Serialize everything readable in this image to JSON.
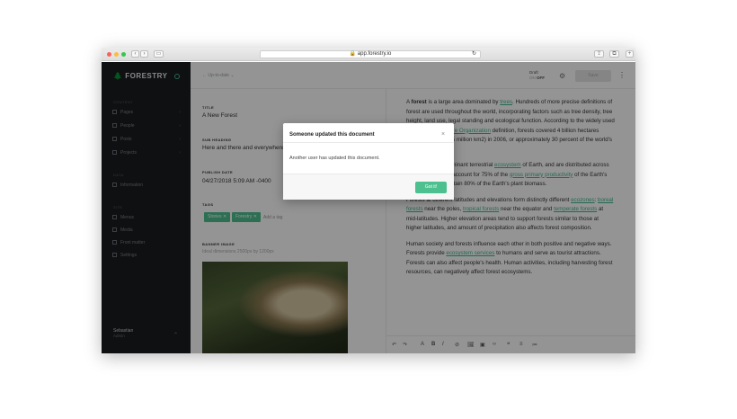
{
  "browser": {
    "url": "app.forestry.io",
    "buttons": {
      "back": "‹",
      "forward": "›",
      "sidebar": "▭",
      "reload": "↻",
      "share": "⇪",
      "tabs": "⧉",
      "add": "+"
    },
    "traffic_colors": [
      "#fc605b",
      "#fdbc40",
      "#34c84a"
    ]
  },
  "sidebar": {
    "logo": "FORESTRY",
    "sections": [
      {
        "title": "CONTENT",
        "items": [
          {
            "label": "Pages",
            "icon": "page-icon",
            "count": "›"
          },
          {
            "label": "People",
            "icon": "people-icon",
            "count": "›"
          },
          {
            "label": "Posts",
            "icon": "posts-icon",
            "count": "›"
          },
          {
            "label": "Projects",
            "icon": "projects-icon",
            "count": "›"
          }
        ]
      },
      {
        "title": "DATA",
        "items": [
          {
            "label": "Information",
            "icon": "info-icon",
            "count": ""
          }
        ]
      },
      {
        "title": "SITE",
        "items": [
          {
            "label": "Menus",
            "icon": "menu-icon",
            "count": ""
          },
          {
            "label": "Media",
            "icon": "media-icon",
            "count": ""
          },
          {
            "label": "Front matter",
            "icon": "frontmatter-icon",
            "count": ""
          },
          {
            "label": "Settings",
            "icon": "settings-icon",
            "count": ""
          }
        ]
      }
    ],
    "user": {
      "name": "Sebastian",
      "role": "Admin"
    }
  },
  "topbar": {
    "status": "Up-to-date",
    "draft_label": "Draft",
    "draft_on": "ON",
    "draft_off": "OFF",
    "save": "Save"
  },
  "fields": {
    "title_label": "TITLE",
    "title_value": "A New Forest",
    "sub_label": "SUB HEADING",
    "sub_value": "Here and there and everywhere",
    "date_label": "PUBLISH DATE",
    "date_value": "04/27/2018 5:09 AM -0400",
    "tags_label": "TAGS",
    "tags": [
      "Stories ✕",
      "Forestry ✕"
    ],
    "add_tag": "Add a tag",
    "banner_label": "BANNER IMAGE",
    "banner_hint": "Ideal dimensions 2500px by 1200px"
  },
  "content": {
    "p1": {
      "a": "A ",
      "b": "forest",
      "c": " is a large area dominated by ",
      "link1": "trees",
      "d": ". Hundreds of more precise definitions of forest are used throughout the world, incorporating factors such as tree density, tree height, land use, legal standing and ecological function. According to the widely used ",
      "link2": "Food and Agriculture Organization",
      "e": " definition, forests covered 4 billion hectares (9.9×109 acres) (15 million km2) in 2006, or approximately 30 percent of the world's land area in 2006."
    },
    "p2": {
      "a": "Forests are the dominant terrestrial ",
      "link1": "ecosystem",
      "b": " of Earth, and are distributed across the globe. Forests account for 75% of the ",
      "link2": "gross primary productivity",
      "c": " of the Earth's ",
      "link3": "biosphere",
      "d": ", and contain 80% of the Earth's plant biomass."
    },
    "p3": {
      "a": "Forests at different latitudes and elevations form distinctly different ",
      "link1": "ecozones",
      "b": ": ",
      "link2": "boreal forests",
      "c": " near the poles, ",
      "link3": "tropical forests",
      "d": " near the equator and ",
      "link4": "temperate forests",
      "e": " at mid-latitudes. Higher elevation areas tend to support forests similar to those at higher latitudes, and amount of precipitation also affects forest composition."
    },
    "p4": {
      "a": "Human society and forests influence each other in both positive and negative ways. Forests provide ",
      "link1": "ecosystem services",
      "b": " to humans and serve as tourist attractions. Forests can also affect people's health. Human activities, including harvesting forest resources, can negatively affect forest ecosystems."
    }
  },
  "editor_toolbar": [
    "↶",
    "↷",
    "A",
    "B",
    "I",
    "⊘",
    "🖼",
    "▣",
    "‹›",
    "❝",
    "≡",
    "≔"
  ],
  "modal": {
    "title": "Someone updated this document",
    "body": "Another user has updated this document.",
    "button": "Got it!"
  },
  "colors": {
    "accent": "#4cc08f",
    "sidebar_bg": "#1b1d1f"
  }
}
